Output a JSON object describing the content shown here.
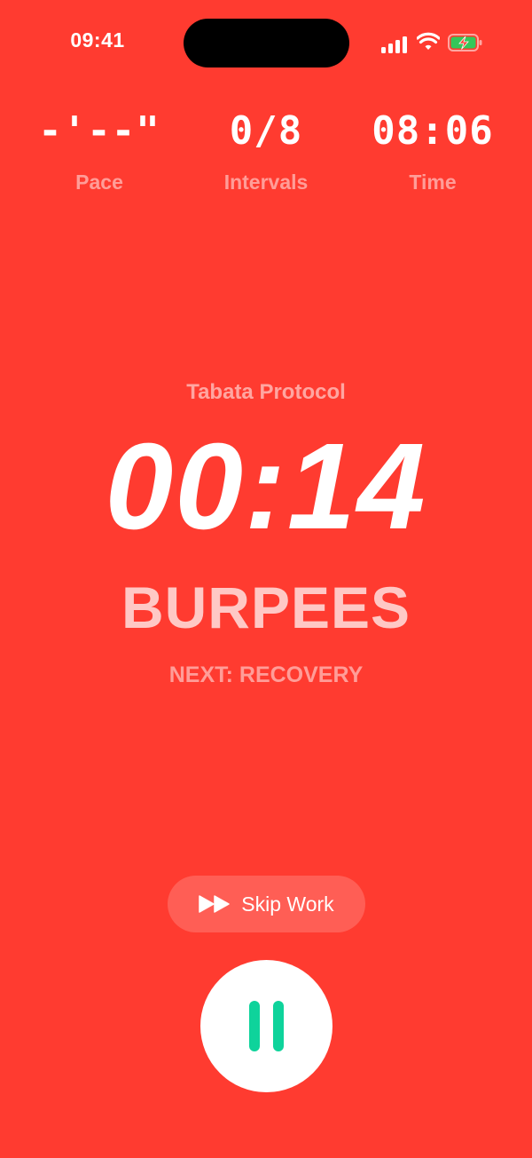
{
  "status_bar": {
    "time": "09:41"
  },
  "metrics": [
    {
      "value": "-'--\"",
      "label": "Pace"
    },
    {
      "value": "0/8",
      "label": "Intervals"
    },
    {
      "value": "08:06",
      "label": "Time"
    }
  ],
  "workout": {
    "protocol": "Tabata Protocol",
    "countdown": "00:14",
    "exercise": "BURPEES",
    "next": "NEXT: RECOVERY"
  },
  "controls": {
    "skip_label": "Skip Work"
  },
  "colors": {
    "background": "#FF3B30",
    "pause_icon": "#0ED39B",
    "battery_fill": "#34C759"
  },
  "icons": {
    "signal": "cellular-signal-icon",
    "wifi": "wifi-icon",
    "battery": "battery-charging-icon",
    "skip": "fast-forward-icon",
    "pause": "pause-icon"
  }
}
